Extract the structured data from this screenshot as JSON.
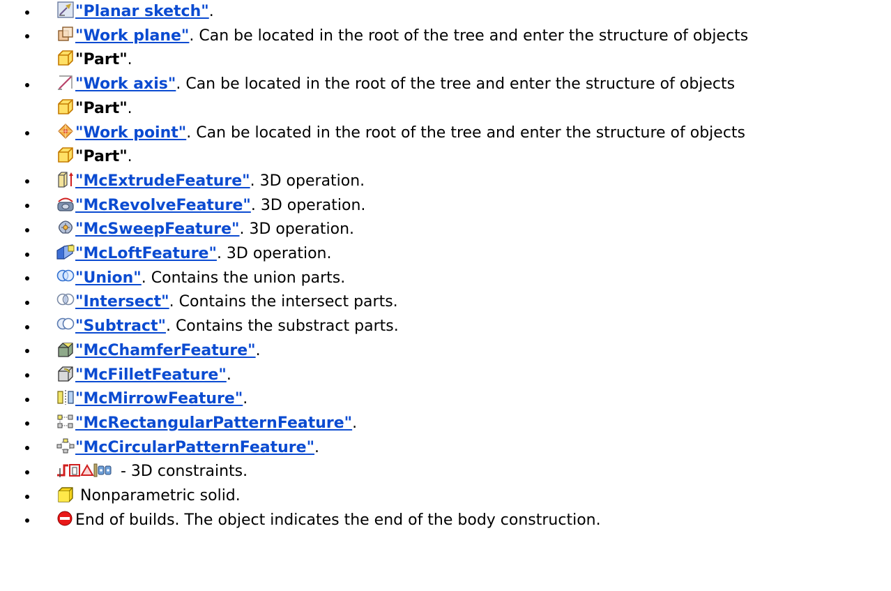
{
  "items": [
    {
      "icon": "planar-sketch-icon",
      "link": "\"Planar sketch\"",
      "text": "."
    },
    {
      "icon": "work-plane-icon",
      "link": "\"Work plane\"",
      "text": ". Can be located in the root of the tree and enter the structure of objects",
      "part_icon": "part-cube-icon",
      "part": "\"Part\"",
      "part_tail": "."
    },
    {
      "icon": "work-axis-icon",
      "link": "\"Work axis\"",
      "text": ". Can be located in the root of the tree and enter the structure of objects",
      "part_icon": "part-cube-icon",
      "part": "\"Part\"",
      "part_tail": "."
    },
    {
      "icon": "work-point-icon",
      "link": "\"Work point\"",
      "text": ". Can be located in the root of the tree and enter the structure of objects",
      "part_icon": "part-cube-icon",
      "part": "\"Part\"",
      "part_tail": "."
    },
    {
      "icon": "extrude-feature-icon",
      "link": "\"McExtrudeFeature\"",
      "text": ". 3D operation."
    },
    {
      "icon": "revolve-feature-icon",
      "link": "\"McRevolveFeature\"",
      "text": ". 3D operation."
    },
    {
      "icon": "sweep-feature-icon",
      "link": "\"McSweepFeature\"",
      "text": ". 3D operation."
    },
    {
      "icon": "loft-feature-icon",
      "link": "\"McLoftFeature\"",
      "text": ". 3D operation."
    },
    {
      "icon": "union-icon",
      "link": "\"Union\"",
      "text": ". Contains the union parts."
    },
    {
      "icon": "intersect-icon",
      "link": "\"Intersect\"",
      "text": ". Contains the intersect parts."
    },
    {
      "icon": "subtract-icon",
      "link": "\"Subtract\"",
      "text": ". Contains the substract parts."
    },
    {
      "icon": "chamfer-feature-icon",
      "link": "\"McChamferFeature\"",
      "text": "."
    },
    {
      "icon": "fillet-feature-icon",
      "link": "\"McFilletFeature\"",
      "text": "."
    },
    {
      "icon": "mirror-feature-icon",
      "link": "\"McMirrowFeature\"",
      "text": "."
    },
    {
      "icon": "rectangular-pattern-icon",
      "link": "\"McRectangularPatternFeature\"",
      "text": "."
    },
    {
      "icon": "circular-pattern-icon",
      "link": "\"McCircularPatternFeature\"",
      "text": "."
    },
    {
      "icon": "3d-constraints-icons",
      "link": "",
      "text": " - 3D constraints."
    },
    {
      "icon": "nonparametric-solid-icon",
      "link": "",
      "text": " Nonparametric solid."
    },
    {
      "icon": "end-of-builds-icon",
      "link": "",
      "text": "End of builds. The object indicates the end of the body construction."
    }
  ],
  "colors": {
    "link": "#0b4bd1",
    "text": "#000000",
    "background": "#ffffff"
  }
}
